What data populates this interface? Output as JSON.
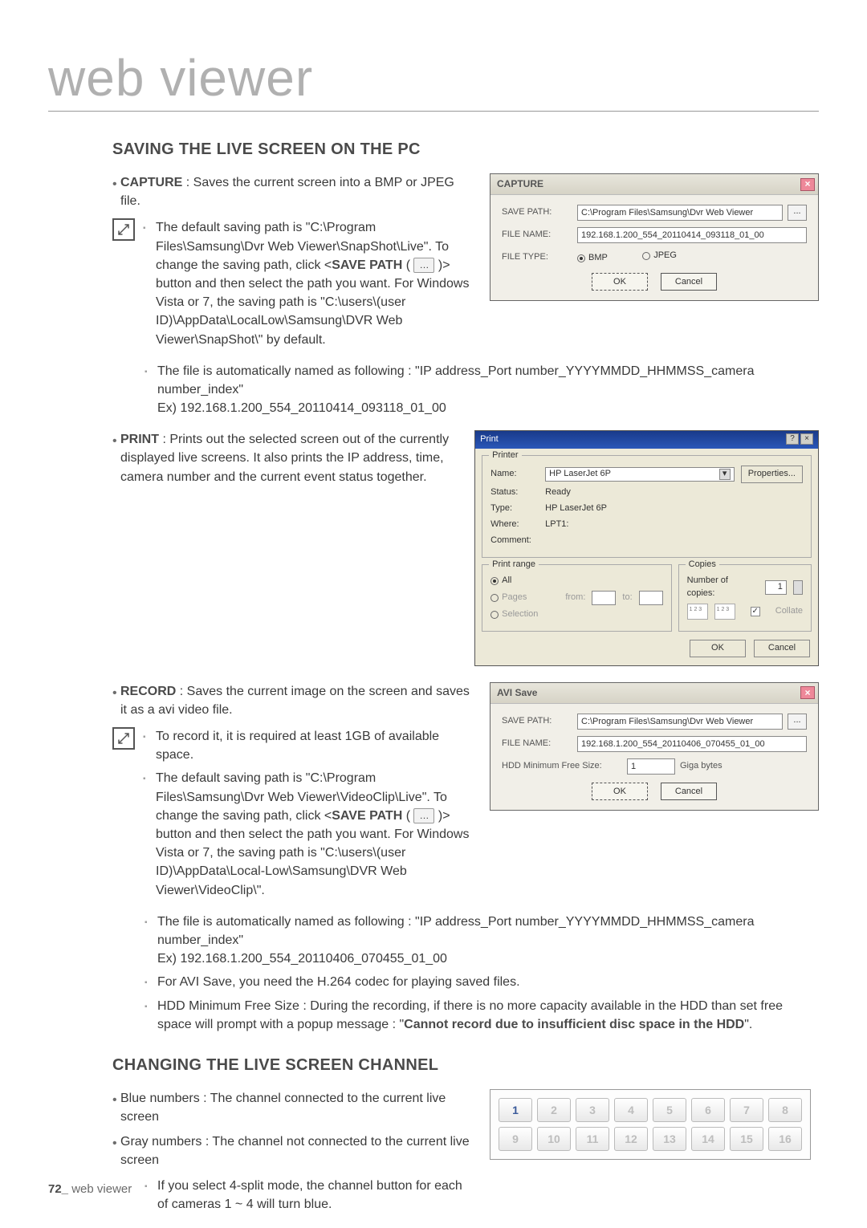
{
  "page": {
    "title": "web viewer",
    "footer_page": "72_",
    "footer_label": "web viewer"
  },
  "section1": {
    "heading": "SAVING THE LIVE SCREEN ON THE PC",
    "capture": {
      "label": "CAPTURE",
      "desc": " : Saves the current screen into a BMP or JPEG file."
    },
    "note1": "The default saving path is \"C:\\Program Files\\Samsung\\Dvr Web Viewer\\SnapShot\\Live\". To change the saving path, click <",
    "note1_bold": "SAVE PATH",
    "note1_btn": "…",
    "note1_after": " )> button and then select the path you want. For Windows Vista or 7, the saving path is \"C:\\users\\(user ID)\\AppData\\LocalLow\\Samsung\\DVR Web Viewer\\SnapShot\\\" by default.",
    "note2": "The file is automatically named as following : \"IP address_Port number_YYYYMMDD_HHMMSS_camera number_index\"",
    "note2_ex": "Ex) 192.168.1.200_554_20110414_093118_01_00",
    "print": {
      "label": "PRINT",
      "desc": " : Prints out the selected screen out of the currently displayed live screens. It also prints the IP address, time, camera number and the current event status together."
    },
    "record": {
      "label": "RECORD",
      "desc": " : Saves the current image on the screen and saves it as a avi video file."
    },
    "rec_items": [
      "To record it, it is required at least 1GB of available space.",
      "",
      "The file is automatically named as following : \"IP address_Port number_YYYYMMDD_HHMMSS_camera number_index\"",
      "For AVI Save, you need the H.264 codec for playing saved files.",
      ""
    ],
    "rec_item2_pre": "The default saving path is \"C:\\Program Files\\Samsung\\Dvr Web Viewer\\VideoClip\\Live\". To change the saving path, click <",
    "rec_item2_bold": "SAVE PATH",
    "rec_item2_btn": "…",
    "rec_item2_post": " )> button and then select the path you want. For Windows Vista or 7, the saving path is \"C:\\users\\(user ID)\\AppData\\Local-Low\\Samsung\\DVR Web Viewer\\VideoClip\\\".",
    "rec_item3_ex": "Ex) 192.168.1.200_554_20110406_070455_01_00",
    "rec_item5_pre": "HDD Minimum Free Size : During the recording, if there is no more capacity available in the HDD than set free space will prompt with a popup message : \"",
    "rec_item5_bold": "Cannot record due to insufficient disc space in the HDD",
    "rec_item5_post": "\"."
  },
  "capture_dlg": {
    "title": "CAPTURE",
    "save_path_label": "SAVE PATH:",
    "save_path": "C:\\Program Files\\Samsung\\Dvr Web Viewer",
    "file_name_label": "FILE NAME:",
    "file_name": "192.168.1.200_554_20110414_093118_01_00",
    "file_type_label": "FILE TYPE:",
    "opt_bmp": "BMP",
    "opt_jpeg": "JPEG",
    "ok": "OK",
    "cancel": "Cancel"
  },
  "print_dlg": {
    "title": "Print",
    "printer_legend": "Printer",
    "name_label": "Name:",
    "name_value": "HP LaserJet 6P",
    "props": "Properties...",
    "status_label": "Status:",
    "status_value": "Ready",
    "type_label": "Type:",
    "type_value": "HP LaserJet 6P",
    "where_label": "Where:",
    "where_value": "LPT1:",
    "comment_label": "Comment:",
    "range_legend": "Print range",
    "range_all": "All",
    "range_pages": "Pages",
    "range_from": "from:",
    "range_to": "to:",
    "range_sel": "Selection",
    "copies_legend": "Copies",
    "copies_label": "Number of copies:",
    "copies_value": "1",
    "collate": "Collate",
    "ok": "OK",
    "cancel": "Cancel"
  },
  "avi_dlg": {
    "title": "AVI Save",
    "save_path_label": "SAVE PATH:",
    "save_path": "C:\\Program Files\\Samsung\\Dvr Web Viewer",
    "file_name_label": "FILE NAME:",
    "file_name": "192.168.1.200_554_20110406_070455_01_00",
    "hdd_label": "HDD Minimum Free Size:",
    "hdd_value": "1",
    "hdd_unit": "Giga bytes",
    "ok": "OK",
    "cancel": "Cancel"
  },
  "section2": {
    "heading": "CHANGING THE LIVE SCREEN CHANNEL",
    "blue_desc": "Blue numbers : The channel connected to the current live screen",
    "gray_desc": "Gray numbers : The channel not connected to the current live screen",
    "sub": "If you select 4-split mode, the channel button for each of cameras 1 ~ 4 will turn blue."
  },
  "channels": {
    "items": [
      "1",
      "2",
      "3",
      "4",
      "5",
      "6",
      "7",
      "8",
      "9",
      "10",
      "11",
      "12",
      "13",
      "14",
      "15",
      "16"
    ],
    "blue_first": true
  }
}
